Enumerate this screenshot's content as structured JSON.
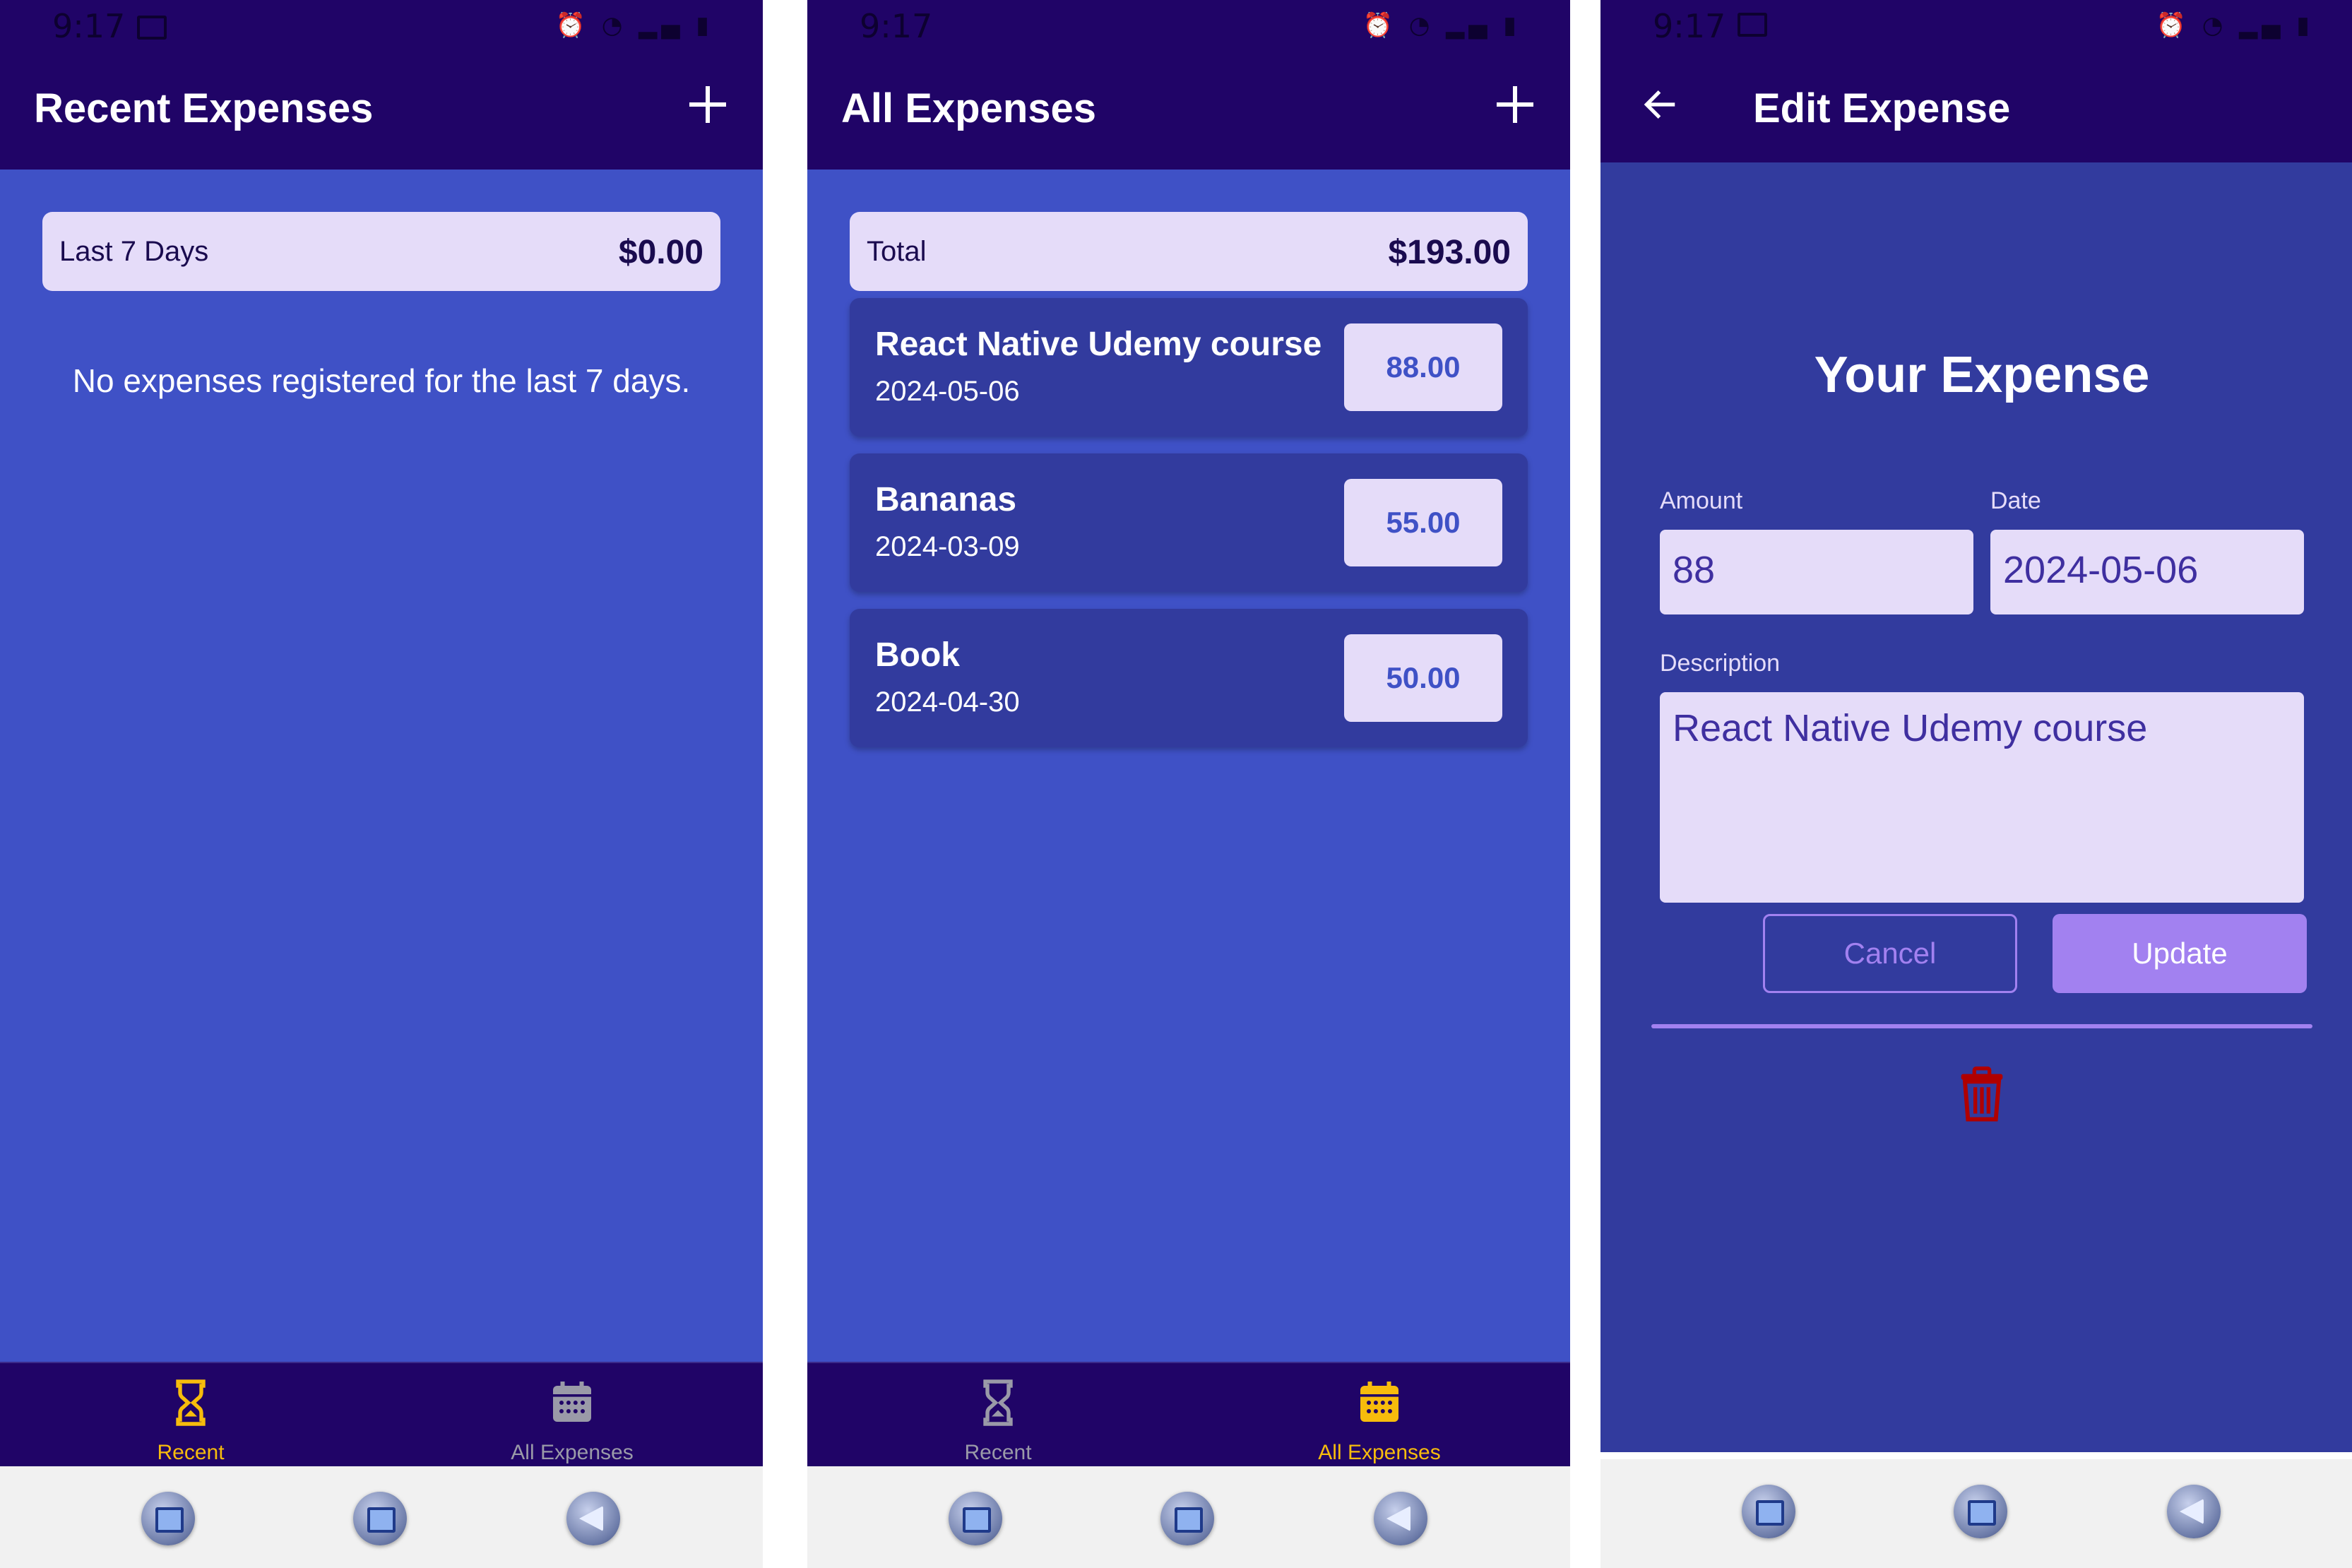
{
  "colors": {
    "header_bg": "#200467",
    "content_bg": "#3f51c6",
    "card_bg": "#323b9e",
    "light_box": "#e5dcf9",
    "accent": "#a281f0",
    "active_tab": "#f7bc0c",
    "inactive_tab": "#9a9aa8",
    "delete": "#b00000"
  },
  "status_bar": [
    {
      "time": "9:17"
    },
    {
      "time": "9:17"
    },
    {
      "time": "9:17"
    }
  ],
  "recent": {
    "title": "Recent Expenses",
    "summary_label": "Last 7 Days",
    "summary_value": "$0.00",
    "empty_message": "No expenses registered for the last 7 days."
  },
  "all": {
    "title": "All Expenses",
    "summary_label": "Total",
    "summary_value": "$193.00",
    "expenses": [
      {
        "title": "React Native Udemy course",
        "date": "2024-05-06",
        "amount": "88.00"
      },
      {
        "title": "Bananas",
        "date": "2024-03-09",
        "amount": "55.00"
      },
      {
        "title": "Book",
        "date": "2024-04-30",
        "amount": "50.00"
      }
    ]
  },
  "edit": {
    "title": "Edit Expense",
    "form_title": "Your Expense",
    "amount_label": "Amount",
    "amount_value": "88",
    "date_label": "Date",
    "date_value": "2024-05-06",
    "description_label": "Description",
    "description_value": "React Native Udemy course",
    "cancel_label": "Cancel",
    "update_label": "Update"
  },
  "tabs": {
    "recent_label": "Recent",
    "all_label": "All Expenses",
    "recent_icon": "hourglass-icon",
    "all_icon": "calendar-icon"
  }
}
